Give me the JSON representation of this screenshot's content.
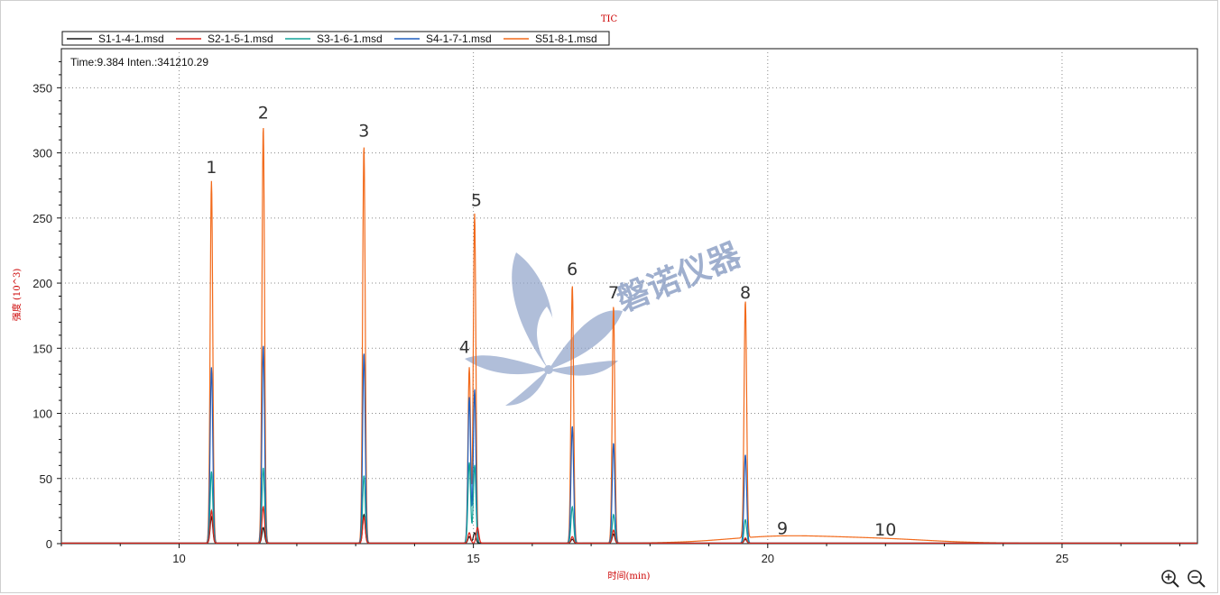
{
  "chart_data": {
    "type": "line",
    "title": "TIC",
    "xlabel": "时间(min)",
    "ylabel": "强度 (10^3)",
    "xlim": [
      8,
      27.3
    ],
    "ylim": [
      0,
      380
    ],
    "x_ticks": [
      10,
      15,
      20,
      25
    ],
    "y_ticks": [
      0,
      50,
      100,
      150,
      200,
      250,
      300,
      350
    ],
    "grid": true,
    "legend_position": "top-left",
    "readout": "Time:9.384  Inten.:341210.29",
    "watermark": "磐诺仪器",
    "series": [
      {
        "name": "S1-1-4-1.msd",
        "color": "#1a1a1a",
        "peaks": [
          [
            10.55,
            20
          ],
          [
            11.43,
            12
          ],
          [
            13.14,
            22
          ],
          [
            14.93,
            5
          ],
          [
            15.02,
            8
          ],
          [
            16.68,
            3
          ],
          [
            17.38,
            7
          ],
          [
            19.62,
            3
          ]
        ]
      },
      {
        "name": "S2-1-5-1.msd",
        "color": "#e0241b",
        "peaks": [
          [
            10.55,
            25
          ],
          [
            11.43,
            28
          ],
          [
            13.14,
            20
          ],
          [
            14.93,
            8
          ],
          [
            15.07,
            12
          ],
          [
            16.68,
            5
          ],
          [
            17.38,
            10
          ],
          [
            19.62,
            4
          ]
        ]
      },
      {
        "name": "S3-1-6-1.msd",
        "color": "#12a39a",
        "peaks": [
          [
            10.55,
            55
          ],
          [
            11.43,
            58
          ],
          [
            13.14,
            52
          ],
          [
            14.93,
            62
          ],
          [
            15.02,
            60
          ],
          [
            16.68,
            28
          ],
          [
            17.38,
            22
          ],
          [
            19.62,
            18
          ]
        ]
      },
      {
        "name": "S4-1-7-1.msd",
        "color": "#1f5fbf",
        "peaks": [
          [
            10.55,
            135
          ],
          [
            11.43,
            152
          ],
          [
            13.14,
            146
          ],
          [
            14.93,
            112
          ],
          [
            15.02,
            118
          ],
          [
            16.68,
            90
          ],
          [
            17.38,
            77
          ],
          [
            19.62,
            68
          ]
        ]
      },
      {
        "name": "S51-8-1.msd",
        "color": "#f26a1b",
        "peaks": [
          [
            10.55,
            278
          ],
          [
            11.43,
            320
          ],
          [
            13.14,
            305
          ],
          [
            14.93,
            135
          ],
          [
            15.02,
            253
          ],
          [
            16.68,
            198
          ],
          [
            17.38,
            182
          ],
          [
            19.62,
            182
          ],
          [
            20.2,
            5
          ],
          [
            21.9,
            3
          ]
        ]
      }
    ],
    "annotations": [
      {
        "text": "1",
        "x": 10.55,
        "y": 283
      },
      {
        "text": "2",
        "x": 11.43,
        "y": 325
      },
      {
        "text": "3",
        "x": 13.14,
        "y": 311
      },
      {
        "text": "4",
        "x": 14.85,
        "y": 145
      },
      {
        "text": "5",
        "x": 15.05,
        "y": 258
      },
      {
        "text": "6",
        "x": 16.68,
        "y": 205
      },
      {
        "text": "7",
        "x": 17.38,
        "y": 187
      },
      {
        "text": "8",
        "x": 19.62,
        "y": 187
      },
      {
        "text": "9",
        "x": 20.25,
        "y": 6
      },
      {
        "text": "10",
        "x": 22.0,
        "y": 5
      }
    ]
  },
  "toolbar": {
    "zoom_in_icon": "zoom-in-icon",
    "zoom_out_icon": "zoom-out-icon"
  }
}
